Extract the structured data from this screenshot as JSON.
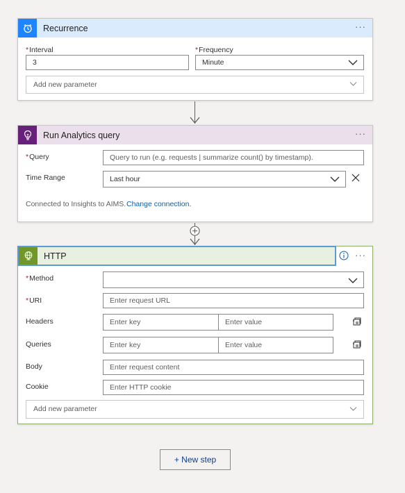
{
  "recurrence": {
    "title": "Recurrence",
    "more": "···",
    "interval_label": "Interval",
    "interval_value": "3",
    "frequency_label": "Frequency",
    "frequency_value": "Minute",
    "add_param": "Add new parameter",
    "header_color": "#d9ebfc",
    "icon_color": "#1f85ff"
  },
  "analytics": {
    "title": "Run Analytics query",
    "more": "···",
    "query_label": "Query",
    "query_placeholder": "Query to run (e.g. requests | summarize count() by timestamp).",
    "time_range_label": "Time Range",
    "time_range_value": "Last hour",
    "connected_text": "Connected to Insights to AIMS.",
    "change_connection": "Change connection.",
    "header_color": "#ebdfeb",
    "icon_color": "#68217a"
  },
  "http": {
    "title": "HTTP",
    "more": "···",
    "method_label": "Method",
    "method_value": "",
    "uri_label": "URI",
    "uri_placeholder": "Enter request URL",
    "headers_label": "Headers",
    "queries_label": "Queries",
    "key_placeholder": "Enter key",
    "value_placeholder": "Enter value",
    "body_label": "Body",
    "body_placeholder": "Enter request content",
    "cookie_label": "Cookie",
    "cookie_placeholder": "Enter HTTP cookie",
    "add_param": "Add new parameter",
    "header_color": "#e8f0df",
    "icon_color": "#709727",
    "accent_border": "#5b9bd5"
  },
  "new_step": "+ New step",
  "required_marker": "*"
}
